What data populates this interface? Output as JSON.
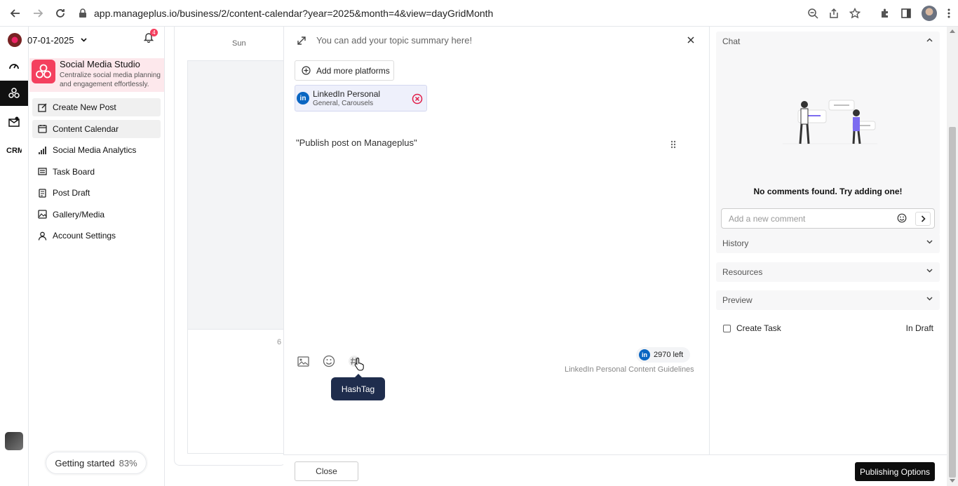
{
  "browser": {
    "url": "app.manageplus.io/business/2/content-calendar?year=2025&month=4&view=dayGridMonth"
  },
  "sidebar": {
    "date": "07-01-2025",
    "notification_count": "4",
    "studio_title": "Social Media Studio",
    "studio_desc_line1": "Centralize social media planning",
    "studio_desc_line2": "and engagement effortlessly.",
    "items": [
      {
        "label": "Create New Post",
        "icon": "edit-icon"
      },
      {
        "label": "Content Calendar",
        "icon": "calendar-icon"
      },
      {
        "label": "Social Media Analytics",
        "icon": "analytics-icon"
      },
      {
        "label": "Task Board",
        "icon": "task-board-icon"
      },
      {
        "label": "Post Draft",
        "icon": "draft-icon"
      },
      {
        "label": "Gallery/Media",
        "icon": "gallery-icon"
      },
      {
        "label": "Account Settings",
        "icon": "user-icon"
      }
    ],
    "getting_started_label": "Getting started",
    "getting_started_pct": "83%"
  },
  "calendar": {
    "day_header": "Sun",
    "date_number": "6"
  },
  "editor": {
    "summary_placeholder": "You can add your topic summary here!",
    "add_platforms_label": "Add more platforms",
    "platform": {
      "name": "LinkedIn Personal",
      "types": "General, Carousels",
      "icon_letters": "in"
    },
    "content_text": "\"Publish post on Manageplus\"",
    "tooltip": "HashTag",
    "chars_left": "2970 left",
    "guidelines": "LinkedIn Personal Content Guidelines"
  },
  "footer": {
    "close_label": "Close",
    "publish_label": "Publishing Options"
  },
  "right_panel": {
    "chat_title": "Chat",
    "no_comments": "No comments found. Try adding one!",
    "comment_placeholder": "Add a new comment",
    "history_title": "History",
    "resources_title": "Resources",
    "preview_title": "Preview",
    "task_label": "Create Task",
    "task_status": "In Draft"
  }
}
